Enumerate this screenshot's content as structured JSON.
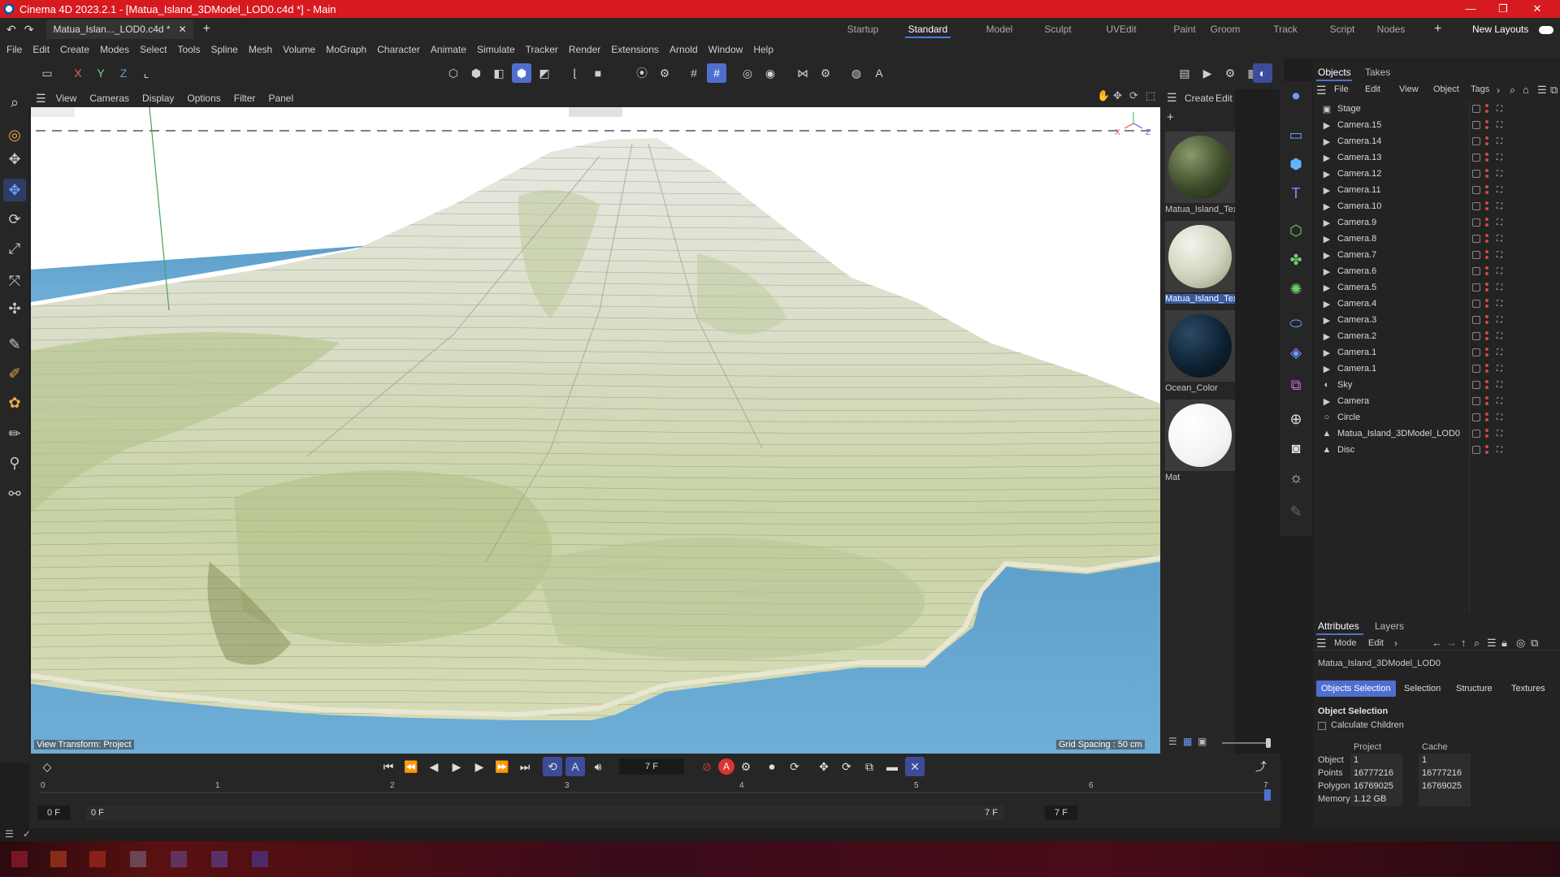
{
  "window": {
    "title": "Cinema 4D 2023.2.1 - [Matua_Island_3DModel_LOD0.c4d *] - Main",
    "minimize": "—",
    "maximize": "❐",
    "close": "✕"
  },
  "document_tab": {
    "label": "Matua_Islan..._LOD0.c4d *",
    "close": "✕",
    "add": "+"
  },
  "layouts": [
    "Startup",
    "Standard",
    "Model",
    "Sculpt",
    "UVEdit",
    "Paint",
    "Groom",
    "Track",
    "Script",
    "Nodes"
  ],
  "active_layout": "Standard",
  "new_layouts_label": "New Layouts",
  "menu": [
    "File",
    "Edit",
    "Create",
    "Modes",
    "Select",
    "Tools",
    "Spline",
    "Mesh",
    "Volume",
    "MoGraph",
    "Character",
    "Animate",
    "Simulate",
    "Tracker",
    "Render",
    "Extensions",
    "Arnold",
    "Window",
    "Help"
  ],
  "axis_buttons": [
    "X",
    "Y",
    "Z"
  ],
  "viewport": {
    "menu": [
      "View",
      "Cameras",
      "Display",
      "Options",
      "Filter",
      "Panel"
    ],
    "view_transform": "View Transform: Project",
    "grid_spacing": "Grid Spacing : 50 cm",
    "axis_x": "X",
    "axis_z": "Z"
  },
  "material_panel": {
    "menu": [
      "Create",
      "Edit"
    ],
    "materials": [
      {
        "name": "Matua_Island_Text",
        "color": "#4a5a38"
      },
      {
        "name": "Matua_Island_Text",
        "color": "#c8cbb8"
      },
      {
        "name": "Ocean_Color",
        "color": "#0e2233"
      },
      {
        "name": "Mat",
        "color": "#ffffff"
      }
    ]
  },
  "objects_panel": {
    "tabs": [
      "Objects",
      "Takes"
    ],
    "menu": [
      "File",
      "Edit",
      "View",
      "Object",
      "Tags"
    ],
    "objects": [
      {
        "name": "Stage",
        "icon": "stage-icon",
        "glyph": "▣"
      },
      {
        "name": "Camera.15",
        "icon": "camera-icon",
        "glyph": "▶"
      },
      {
        "name": "Camera.14",
        "icon": "camera-icon",
        "glyph": "▶"
      },
      {
        "name": "Camera.13",
        "icon": "camera-icon",
        "glyph": "▶"
      },
      {
        "name": "Camera.12",
        "icon": "camera-icon",
        "glyph": "▶"
      },
      {
        "name": "Camera.11",
        "icon": "camera-icon",
        "glyph": "▶"
      },
      {
        "name": "Camera.10",
        "icon": "camera-icon",
        "glyph": "▶"
      },
      {
        "name": "Camera.9",
        "icon": "camera-icon",
        "glyph": "▶"
      },
      {
        "name": "Camera.8",
        "icon": "camera-icon",
        "glyph": "▶"
      },
      {
        "name": "Camera.7",
        "icon": "camera-icon",
        "glyph": "▶"
      },
      {
        "name": "Camera.6",
        "icon": "camera-icon",
        "glyph": "▶"
      },
      {
        "name": "Camera.5",
        "icon": "camera-icon",
        "glyph": "▶"
      },
      {
        "name": "Camera.4",
        "icon": "camera-icon",
        "glyph": "▶"
      },
      {
        "name": "Camera.3",
        "icon": "camera-icon",
        "glyph": "▶"
      },
      {
        "name": "Camera.2",
        "icon": "camera-icon",
        "glyph": "▶"
      },
      {
        "name": "Camera.1",
        "icon": "camera-icon",
        "glyph": "▶"
      },
      {
        "name": "Camera.1",
        "icon": "camera-icon",
        "glyph": "▶"
      },
      {
        "name": "Sky",
        "icon": "sky-icon",
        "glyph": "◐"
      },
      {
        "name": "Camera",
        "icon": "camera-icon",
        "glyph": "▶"
      },
      {
        "name": "Circle",
        "icon": "circle-icon",
        "glyph": "○"
      },
      {
        "name": "Matua_Island_3DModel_LOD0",
        "icon": "polygon-object-icon",
        "glyph": "▲"
      },
      {
        "name": "Disc",
        "icon": "polygon-object-icon",
        "glyph": "▲"
      }
    ]
  },
  "attributes": {
    "tabs": [
      "Attributes",
      "Layers"
    ],
    "menu": [
      "Mode",
      "Edit"
    ],
    "object_name": "Matua_Island_3DModel_LOD0",
    "sub_tabs": [
      "Objects Selection",
      "Selection",
      "Structure",
      "Textures"
    ],
    "section_title": "Object Selection",
    "calculate_children": "Calculate Children",
    "columns": [
      "Project",
      "Cache"
    ],
    "rows": [
      {
        "label": "Object",
        "project": "1",
        "cache": "1"
      },
      {
        "label": "Points",
        "project": "16777216",
        "cache": "16777216"
      },
      {
        "label": "Polygons",
        "project": "16769025",
        "cache": "16769025"
      },
      {
        "label": "Memory",
        "project": "1.12 GB",
        "cache": ""
      }
    ]
  },
  "timeline": {
    "current_frame": "7 F",
    "ruler": [
      "0",
      "1",
      "2",
      "3",
      "4",
      "5",
      "6",
      "7"
    ],
    "start": "0 F",
    "min": "0 F",
    "max": "7 F",
    "end": "7 F",
    "record_label": "A"
  },
  "colors": {
    "titlebar": "#d71a1f",
    "accent": "#4f6fd0",
    "panel": "#262626",
    "ocean": "#6aa6cc",
    "terrain_light": "#dfe3c7",
    "terrain_green": "#b9c796"
  }
}
